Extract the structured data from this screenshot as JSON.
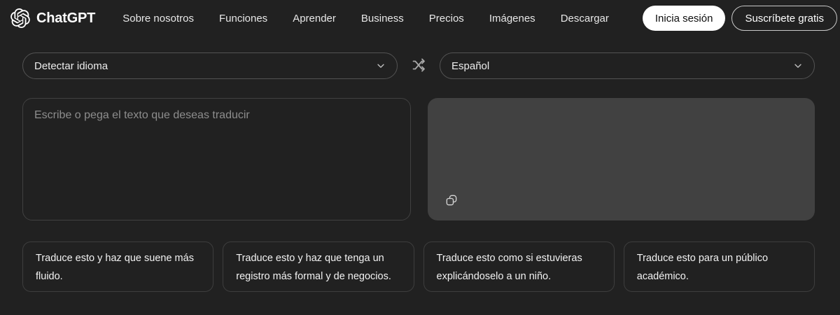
{
  "header": {
    "brand": "ChatGPT",
    "nav_items": [
      "Sobre nosotros",
      "Funciones",
      "Aprender",
      "Business",
      "Precios",
      "Imágenes",
      "Descargar"
    ],
    "login_label": "Inicia sesión",
    "subscribe_label": "Suscríbete gratis"
  },
  "translator": {
    "source_language_selected": "Detectar idioma",
    "target_language_selected": "Español",
    "input_placeholder": "Escribe o pega el texto que deseas traducir",
    "output_text": "",
    "icons": {
      "swap": "shuffle-crossed-arrows",
      "copy": "overlapping-squares",
      "dropdown": "chevron-down",
      "brand": "openai-logo"
    }
  },
  "suggestions": [
    "Traduce esto y haz que suene más fluido.",
    "Traduce esto y haz que tenga un registro más formal y de negocios.",
    "Traduce esto como si estuvieras explicándoselo a un niño.",
    "Traduce esto para un público académico."
  ],
  "colors": {
    "background": "#212121",
    "output_panel": "#414141",
    "panel_border": "#414141",
    "select_border": "#535353",
    "suggestion_border": "#3e3e3e",
    "text_primary": "#ececec",
    "placeholder": "#8d8d8d",
    "login_pill_bg": "#ffffff",
    "login_pill_text": "#0d0d0d",
    "icon_gray": "#b0b0b0"
  }
}
